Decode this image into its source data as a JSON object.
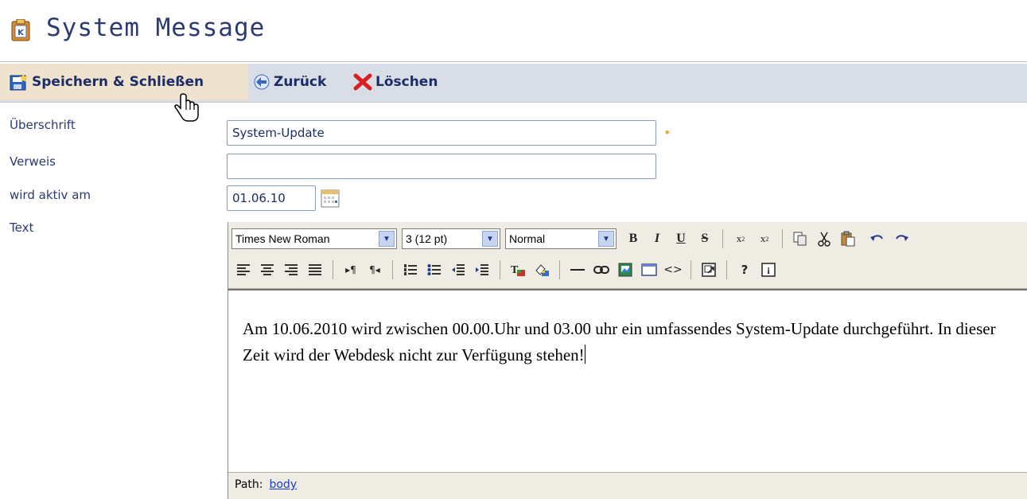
{
  "title": "System Message",
  "toolbar": {
    "save_label": "Speichern & Schließen",
    "back_label": "Zurück",
    "delete_label": "Löschen"
  },
  "form": {
    "heading_label": "Überschrift",
    "heading_value": "System-Update",
    "link_label": "Verweis",
    "link_value": "",
    "active_label": "wird aktiv am",
    "active_value": "01.06.10",
    "text_label": "Text"
  },
  "editor": {
    "font": "Times New Roman",
    "size": "3 (12 pt)",
    "style": "Normal",
    "content": "Am 10.06.2010 wird zwischen 00.00.Uhr und 03.00 uhr ein umfassendes System-Update durchgeführt. In dieser Zeit wird der Webdesk nicht zur Verfügung stehen!",
    "path_label": "Path:",
    "path_link": "body"
  },
  "colors": {
    "title": "#2c3b73",
    "toolbar_bg": "#d9dde6",
    "save_highlight": "#efe2cf",
    "editor_toolbar_bg": "#efece3",
    "required_marker": "#f2a93b"
  }
}
